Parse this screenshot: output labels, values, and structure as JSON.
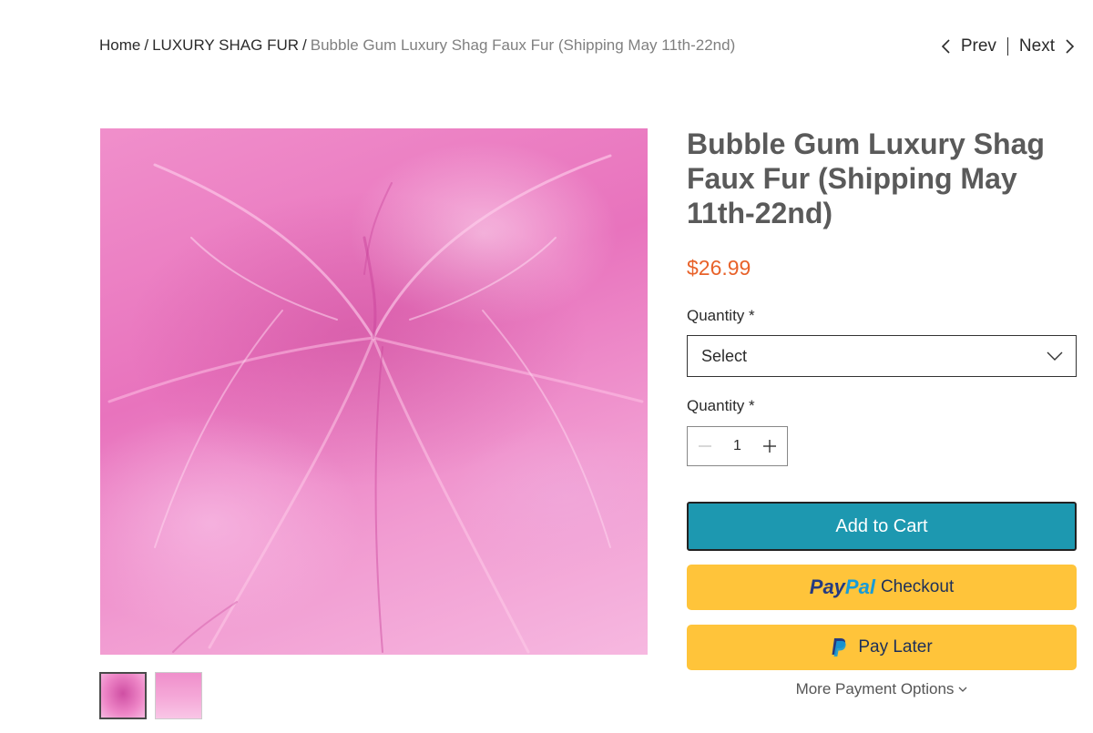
{
  "breadcrumb": {
    "home": "Home",
    "separator": "/",
    "category": "LUXURY SHAG FUR",
    "current": "Bubble Gum Luxury Shag Faux Fur (Shipping May 11th-22nd)"
  },
  "pager": {
    "prev": "Prev",
    "next": "Next"
  },
  "product": {
    "title": "Bubble Gum Luxury Shag Faux Fur (Shipping May 11th-22nd)",
    "price": "$26.99",
    "image_color": "#e873bd"
  },
  "options": {
    "quantity_label": "Quantity *",
    "select_value": "Select",
    "quantity_label_2": "Quantity *",
    "quantity_value": "1"
  },
  "actions": {
    "add_to_cart": "Add to Cart",
    "paypal_word_1": "Pay",
    "paypal_word_2": "Pal",
    "checkout": "Checkout",
    "pay_later": "Pay Later",
    "more_payment_options": "More Payment Options"
  },
  "colors": {
    "price": "#e8622a",
    "add_to_cart_bg": "#1d98b0",
    "paypal_bg": "#ffc43a",
    "paypal_dark": "#253b80",
    "paypal_light": "#179bd7"
  },
  "icons": {
    "prev": "chevron-left-icon",
    "next": "chevron-right-icon",
    "dropdown": "chevron-down-icon",
    "minus": "minus-icon",
    "plus": "plus-icon",
    "paypal": "paypal-logo-icon"
  }
}
